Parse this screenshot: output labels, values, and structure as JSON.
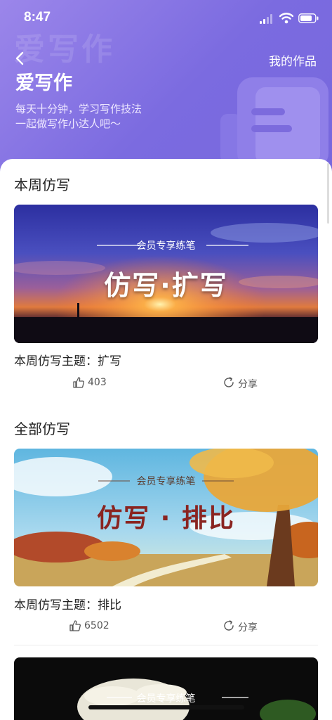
{
  "status_bar": {
    "time": "8:47"
  },
  "header": {
    "watermark_text": "爱写作",
    "title": "爱写作",
    "my_works_label": "我的作品",
    "subtitle_line1": "每天十分钟，学习写作技法",
    "subtitle_line2": "一起做写作小达人吧～"
  },
  "weekly": {
    "section_title": "本周仿写",
    "card": {
      "badge": "会员专享练笔",
      "banner_title": "仿写·扩写",
      "topic": "本周仿写主题：扩写",
      "likes": "403",
      "share_label": "分享"
    }
  },
  "all": {
    "section_title": "全部仿写",
    "cards": [
      {
        "badge": "会员专享练笔",
        "banner_title": "仿写 · 排比",
        "topic": "本周仿写主题：排比",
        "likes": "6502",
        "share_label": "分享"
      },
      {
        "badge": "会员专享练笔"
      }
    ]
  },
  "colors": {
    "header_start": "#9b86ea",
    "header_end": "#7768dd",
    "text_dark": "#222222",
    "banner_text_red": "#8a2420"
  },
  "icons": [
    "back-chevron-icon",
    "signal-icon",
    "wifi-icon",
    "battery-icon",
    "thumbs-up-icon",
    "share-refresh-icon"
  ]
}
